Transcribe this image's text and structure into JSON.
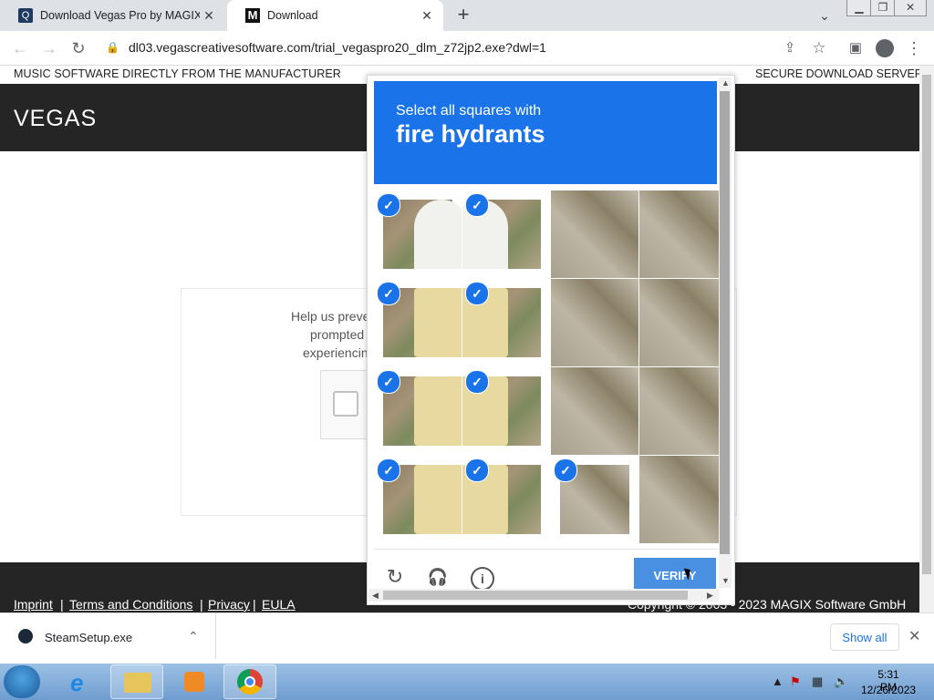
{
  "browser": {
    "tabs": [
      {
        "title": "Download Vegas Pro by MAGIX A",
        "active": false
      },
      {
        "title": "Download",
        "active": true
      }
    ],
    "new_tab": "+",
    "url": "dl03.vegascreativesoftware.com/trial_vegaspro20_dlm_z72jp2.exe?dwl=1"
  },
  "page": {
    "topbar_left": "MUSIC SOFTWARE DIRECTLY FROM THE MANUFACTURER",
    "topbar_right": "SECURE DOWNLOAD SERVER",
    "logo": "VEGAS",
    "help_lines": [
      "Help us preve",
      "prompted",
      "experiencin"
    ],
    "footer_links": [
      "Imprint",
      "Terms and Conditions",
      "Privacy",
      "EULA"
    ],
    "footer_sep": "|",
    "copyright": "Copyright © 2003 - 2023 MAGIX Software GmbH"
  },
  "captcha": {
    "prompt_line1": "Select all squares with",
    "prompt_line2": "fire hydrants",
    "verify_label": "VERIFY",
    "selected_tiles": [
      0,
      1,
      4,
      5,
      8,
      9,
      12,
      13,
      14
    ]
  },
  "download_bar": {
    "file_name": "SteamSetup.exe",
    "show_all": "Show all"
  },
  "taskbar": {
    "time": "5:31 PM",
    "date": "12/26/2023"
  },
  "colors": {
    "captcha_blue": "#1a73e8",
    "header_dark": "#252525"
  }
}
